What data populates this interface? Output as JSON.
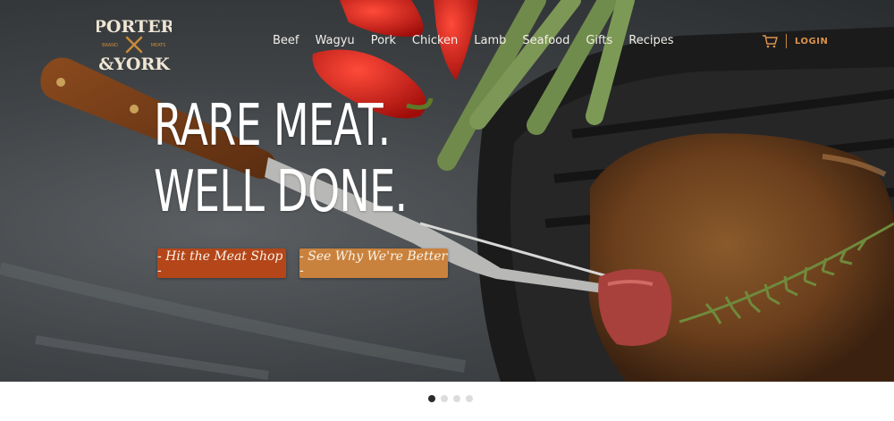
{
  "brand": {
    "line1": "PORTER",
    "line2": "&YORK",
    "small_left": "BRAND",
    "small_right": "MEATS"
  },
  "nav": {
    "items": [
      "Beef",
      "Wagyu",
      "Pork",
      "Chicken",
      "Lamb",
      "Seafood",
      "Gifts",
      "Recipes"
    ],
    "login_label": "LOGIN"
  },
  "hero": {
    "headline_line1": "RARE MEAT.",
    "headline_line2": "WELL DONE.",
    "primary_button": "- Hit the Meat Shop -",
    "secondary_button": "- See Why We're Better -"
  },
  "carousel": {
    "slide_count": 4,
    "active_index": 0
  },
  "colors": {
    "primary_button": "#b4461a",
    "secondary_button": "#c9823e",
    "accent": "#d9924a"
  }
}
